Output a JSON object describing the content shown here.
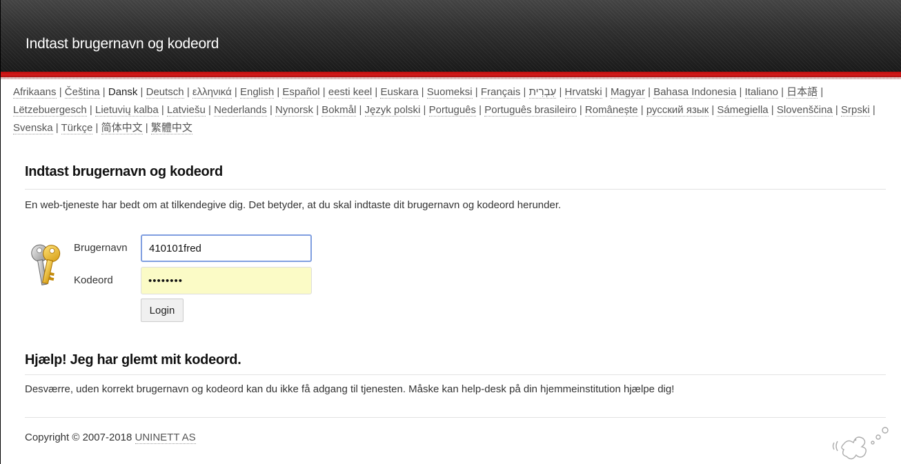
{
  "header": {
    "title": "Indtast brugernavn og kodeord"
  },
  "languages": [
    {
      "label": "Afrikaans",
      "current": false
    },
    {
      "label": "Čeština",
      "current": false
    },
    {
      "label": "Dansk",
      "current": true
    },
    {
      "label": "Deutsch",
      "current": false
    },
    {
      "label": "ελληνικά",
      "current": false
    },
    {
      "label": "English",
      "current": false
    },
    {
      "label": "Español",
      "current": false
    },
    {
      "label": "eesti keel",
      "current": false
    },
    {
      "label": "Euskara",
      "current": false
    },
    {
      "label": "Suomeksi",
      "current": false
    },
    {
      "label": "Français",
      "current": false
    },
    {
      "label": "עִבְרִית",
      "current": false
    },
    {
      "label": "Hrvatski",
      "current": false
    },
    {
      "label": "Magyar",
      "current": false
    },
    {
      "label": "Bahasa Indonesia",
      "current": false
    },
    {
      "label": "Italiano",
      "current": false
    },
    {
      "label": "日本語",
      "current": false
    },
    {
      "label": "Lëtzebuergesch",
      "current": false
    },
    {
      "label": "Lietuvių kalba",
      "current": false
    },
    {
      "label": "Latviešu",
      "current": false
    },
    {
      "label": "Nederlands",
      "current": false
    },
    {
      "label": "Nynorsk",
      "current": false
    },
    {
      "label": "Bokmål",
      "current": false
    },
    {
      "label": "Język polski",
      "current": false
    },
    {
      "label": "Português",
      "current": false
    },
    {
      "label": "Português brasileiro",
      "current": false
    },
    {
      "label": "Românește",
      "current": false
    },
    {
      "label": "русский язык",
      "current": false
    },
    {
      "label": "Sámegiella",
      "current": false
    },
    {
      "label": "Slovenščina",
      "current": false
    },
    {
      "label": "Srpski",
      "current": false
    },
    {
      "label": "Svenska",
      "current": false
    },
    {
      "label": "Türkçe",
      "current": false
    },
    {
      "label": "简体中文",
      "current": false
    },
    {
      "label": "繁體中文",
      "current": false
    }
  ],
  "login": {
    "heading": "Indtast brugernavn og kodeord",
    "intro": "En web-tjeneste har bedt om at tilkendegive dig. Det betyder, at du skal indtaste dit brugernavn og kodeord herunder.",
    "username_label": "Brugernavn",
    "username_value": "410101fred",
    "password_label": "Kodeord",
    "password_value": "••••••••",
    "login_button": "Login",
    "icon": "key-icon"
  },
  "help": {
    "heading": "Hjælp! Jeg har glemt mit kodeord.",
    "text": "Desværre, uden korrekt brugernavn og kodeord kan du ikke få adgang til tjenesten. Måske kan help-desk på din hjemmeinstitution hjælpe dig!"
  },
  "footer": {
    "copyright": "Copyright © 2007-2018",
    "company": "UNINETT AS",
    "logo": "simplesaml-logo"
  },
  "colors": {
    "header_bg": "#2b2b2b",
    "accent_red": "#c41414",
    "password_bg": "#fbfbc6"
  }
}
